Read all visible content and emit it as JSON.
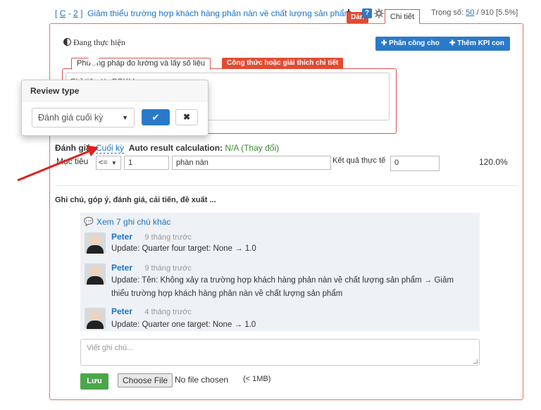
{
  "header": {
    "bracket_open": "[",
    "code_c": "C",
    "dash": "-",
    "code_num": "2",
    "bracket_close": "]",
    "title": "Giảm thiểu trường hợp khách hàng phản nàn về chất lượng sản phẩm",
    "weight_label": "Trọng số:",
    "weight_value": "50",
    "weight_total": "/ 910 [5.5%]",
    "help_label": "?",
    "tab_detail": "Chi tiết",
    "tab_partial": "Dán"
  },
  "status": {
    "label": "Đang thực hiện"
  },
  "actions": {
    "assign": "Phân công cho",
    "add_kpi": "Thêm KPI con"
  },
  "method_tabs": {
    "measure": "Phương pháp đo lường và lấy số liệu",
    "formula": "Công thức hoặc giải thích chi tiết",
    "content": "Chỉ tiêu từ CSKH"
  },
  "popover": {
    "title": "Review type",
    "selected": "Đánh giá cuối kỳ",
    "ok_icon": "✔",
    "cancel_icon": "✖"
  },
  "evaluation": {
    "label": "Đánh giá:",
    "value": "Cuối kỳ",
    "auto_label": "Auto result calculation:",
    "auto_value": "N/A (Thay đổi)"
  },
  "target": {
    "label": "Mục tiêu",
    "operator": "<=",
    "value": "1",
    "unit": "phàn nàn",
    "actual_label": "Kết quả thực tế",
    "actual_value": "0",
    "percent": "120.0%"
  },
  "notes": {
    "title": "Ghi chú, góp ý, đánh giá, cải tiến, đề xuất ...",
    "more": "Xem 7 ghi chú khác",
    "comments": [
      {
        "author": "Peter",
        "time": "9 tháng trước",
        "text": "Update: Quarter four target: None → 1.0"
      },
      {
        "author": "Peter",
        "time": "9 tháng trước",
        "text": "Update: Tên: Không xảy ra trường hợp khách hàng phản nàn về chất lượng sản phẩm → Giảm",
        "text2": "thiểu trường hợp khách hàng phản nàn về chất lượng sản phẩm"
      },
      {
        "author": "Peter",
        "time": "4 tháng trước",
        "text": "Update: Quarter one target: None → 1.0"
      }
    ],
    "input_placeholder": "Viết ghi chú...",
    "save": "Lưu",
    "choose_file": "Choose File",
    "file_status": "No file chosen",
    "file_limit": "(< 1MB)"
  },
  "colors": {
    "accent": "#2a7ac9",
    "danger": "#e24b32",
    "success": "#4ca54c",
    "annotation_arrow": "#e02020"
  }
}
